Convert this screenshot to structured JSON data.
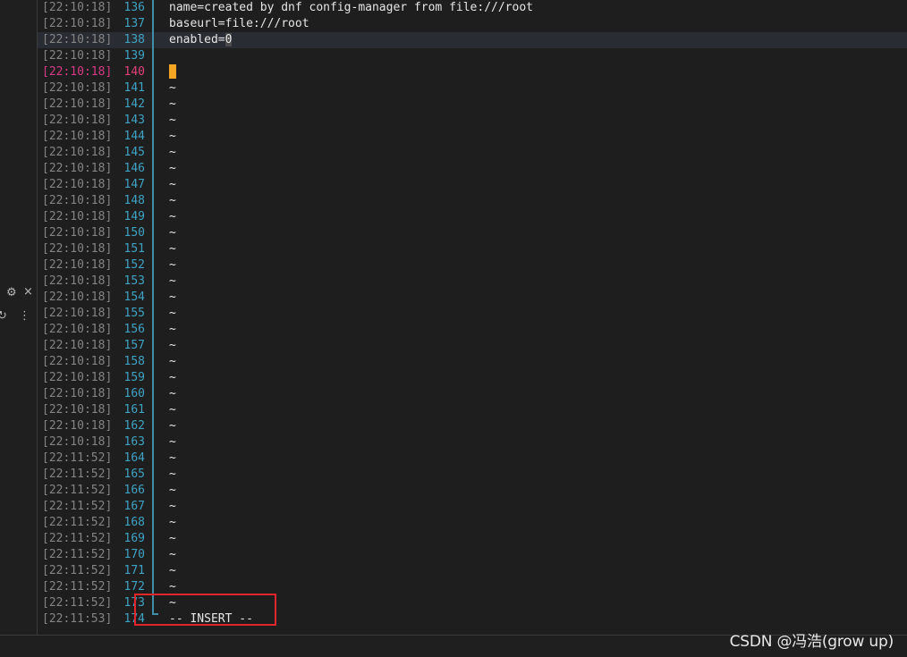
{
  "editor": {
    "lines": [
      {
        "time": "[22:10:18]",
        "num": "136",
        "text": "name=created by dnf config-manager from file:///root"
      },
      {
        "time": "[22:10:18]",
        "num": "137",
        "text": "baseurl=file:///root"
      },
      {
        "time": "[22:10:18]",
        "num": "138",
        "text": "enabled=0",
        "highlight": true
      },
      {
        "time": "[22:10:18]",
        "num": "139",
        "text": ""
      },
      {
        "time": "[22:10:18]",
        "num": "140",
        "text": "",
        "current": true
      },
      {
        "time": "[22:10:18]",
        "num": "141",
        "text": "~"
      },
      {
        "time": "[22:10:18]",
        "num": "142",
        "text": "~"
      },
      {
        "time": "[22:10:18]",
        "num": "143",
        "text": "~"
      },
      {
        "time": "[22:10:18]",
        "num": "144",
        "text": "~"
      },
      {
        "time": "[22:10:18]",
        "num": "145",
        "text": "~"
      },
      {
        "time": "[22:10:18]",
        "num": "146",
        "text": "~"
      },
      {
        "time": "[22:10:18]",
        "num": "147",
        "text": "~"
      },
      {
        "time": "[22:10:18]",
        "num": "148",
        "text": "~"
      },
      {
        "time": "[22:10:18]",
        "num": "149",
        "text": "~"
      },
      {
        "time": "[22:10:18]",
        "num": "150",
        "text": "~"
      },
      {
        "time": "[22:10:18]",
        "num": "151",
        "text": "~"
      },
      {
        "time": "[22:10:18]",
        "num": "152",
        "text": "~"
      },
      {
        "time": "[22:10:18]",
        "num": "153",
        "text": "~"
      },
      {
        "time": "[22:10:18]",
        "num": "154",
        "text": "~"
      },
      {
        "time": "[22:10:18]",
        "num": "155",
        "text": "~"
      },
      {
        "time": "[22:10:18]",
        "num": "156",
        "text": "~"
      },
      {
        "time": "[22:10:18]",
        "num": "157",
        "text": "~"
      },
      {
        "time": "[22:10:18]",
        "num": "158",
        "text": "~"
      },
      {
        "time": "[22:10:18]",
        "num": "159",
        "text": "~"
      },
      {
        "time": "[22:10:18]",
        "num": "160",
        "text": "~"
      },
      {
        "time": "[22:10:18]",
        "num": "161",
        "text": "~"
      },
      {
        "time": "[22:10:18]",
        "num": "162",
        "text": "~"
      },
      {
        "time": "[22:10:18]",
        "num": "163",
        "text": "~"
      },
      {
        "time": "[22:11:52]",
        "num": "164",
        "text": "~"
      },
      {
        "time": "[22:11:52]",
        "num": "165",
        "text": "~"
      },
      {
        "time": "[22:11:52]",
        "num": "166",
        "text": "~"
      },
      {
        "time": "[22:11:52]",
        "num": "167",
        "text": "~"
      },
      {
        "time": "[22:11:52]",
        "num": "168",
        "text": "~"
      },
      {
        "time": "[22:11:52]",
        "num": "169",
        "text": "~"
      },
      {
        "time": "[22:11:52]",
        "num": "170",
        "text": "~"
      },
      {
        "time": "[22:11:52]",
        "num": "171",
        "text": "~"
      },
      {
        "time": "[22:11:52]",
        "num": "172",
        "text": "~"
      },
      {
        "time": "[22:11:52]",
        "num": "173",
        "text": "~"
      },
      {
        "time": "[22:11:53]",
        "num": "174",
        "text": "-- INSERT --",
        "mode": true
      }
    ]
  },
  "side_panel": {
    "icons": [
      "gear-icon",
      "close-icon",
      "refresh-icon",
      "more-vertical-icon"
    ],
    "close_glyph": "×",
    "more_glyph": "⋮"
  },
  "watermark": "CSDN @冯浩(grow up)",
  "colors": {
    "timestamp": "#848484",
    "line_number": "#3fa3c4",
    "current_line": "#e0407a",
    "tilde": "#4d9ce0",
    "cursor": "#f5a623",
    "annotation_box": "#e0262a"
  }
}
